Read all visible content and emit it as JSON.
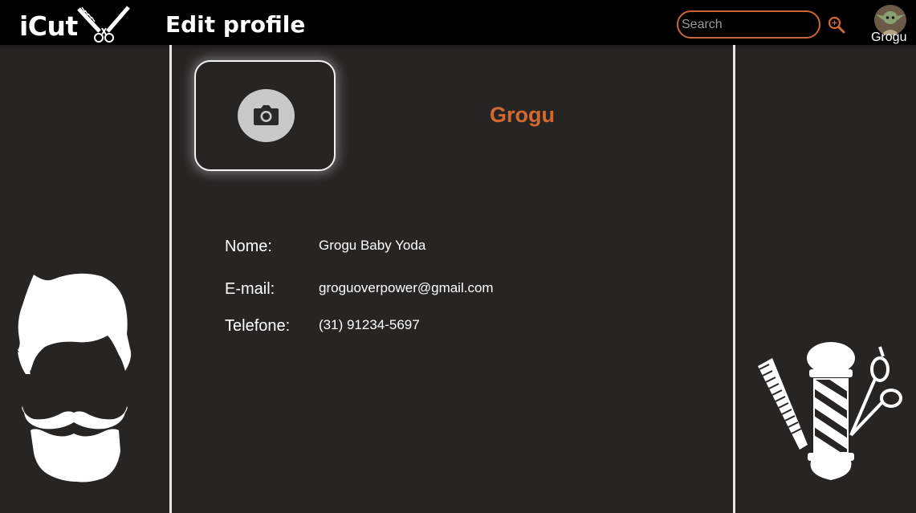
{
  "header": {
    "logo_text": "iCut",
    "page_title": "Edit profile",
    "search": {
      "placeholder": "Search",
      "value": ""
    },
    "user": {
      "name": "Grogu"
    }
  },
  "profile": {
    "display_name": "Grogu",
    "fields": [
      {
        "label": "Nome:",
        "value": "Grogu Baby Yoda"
      },
      {
        "label": "E-mail:",
        "value": "groguoverpower@gmail.com"
      },
      {
        "label": "Telefone:",
        "value": "(31) 91234-5697"
      }
    ]
  },
  "colors": {
    "accent": "#d4692f",
    "background": "#272424",
    "header": "#000000",
    "divider": "#e6e6e6"
  },
  "icons": {
    "logo": "scissors-comb-icon",
    "search": "search-icon",
    "camera": "camera-icon",
    "left_art": "hair-beard-icon",
    "right_art": "barber-pole-icon"
  }
}
